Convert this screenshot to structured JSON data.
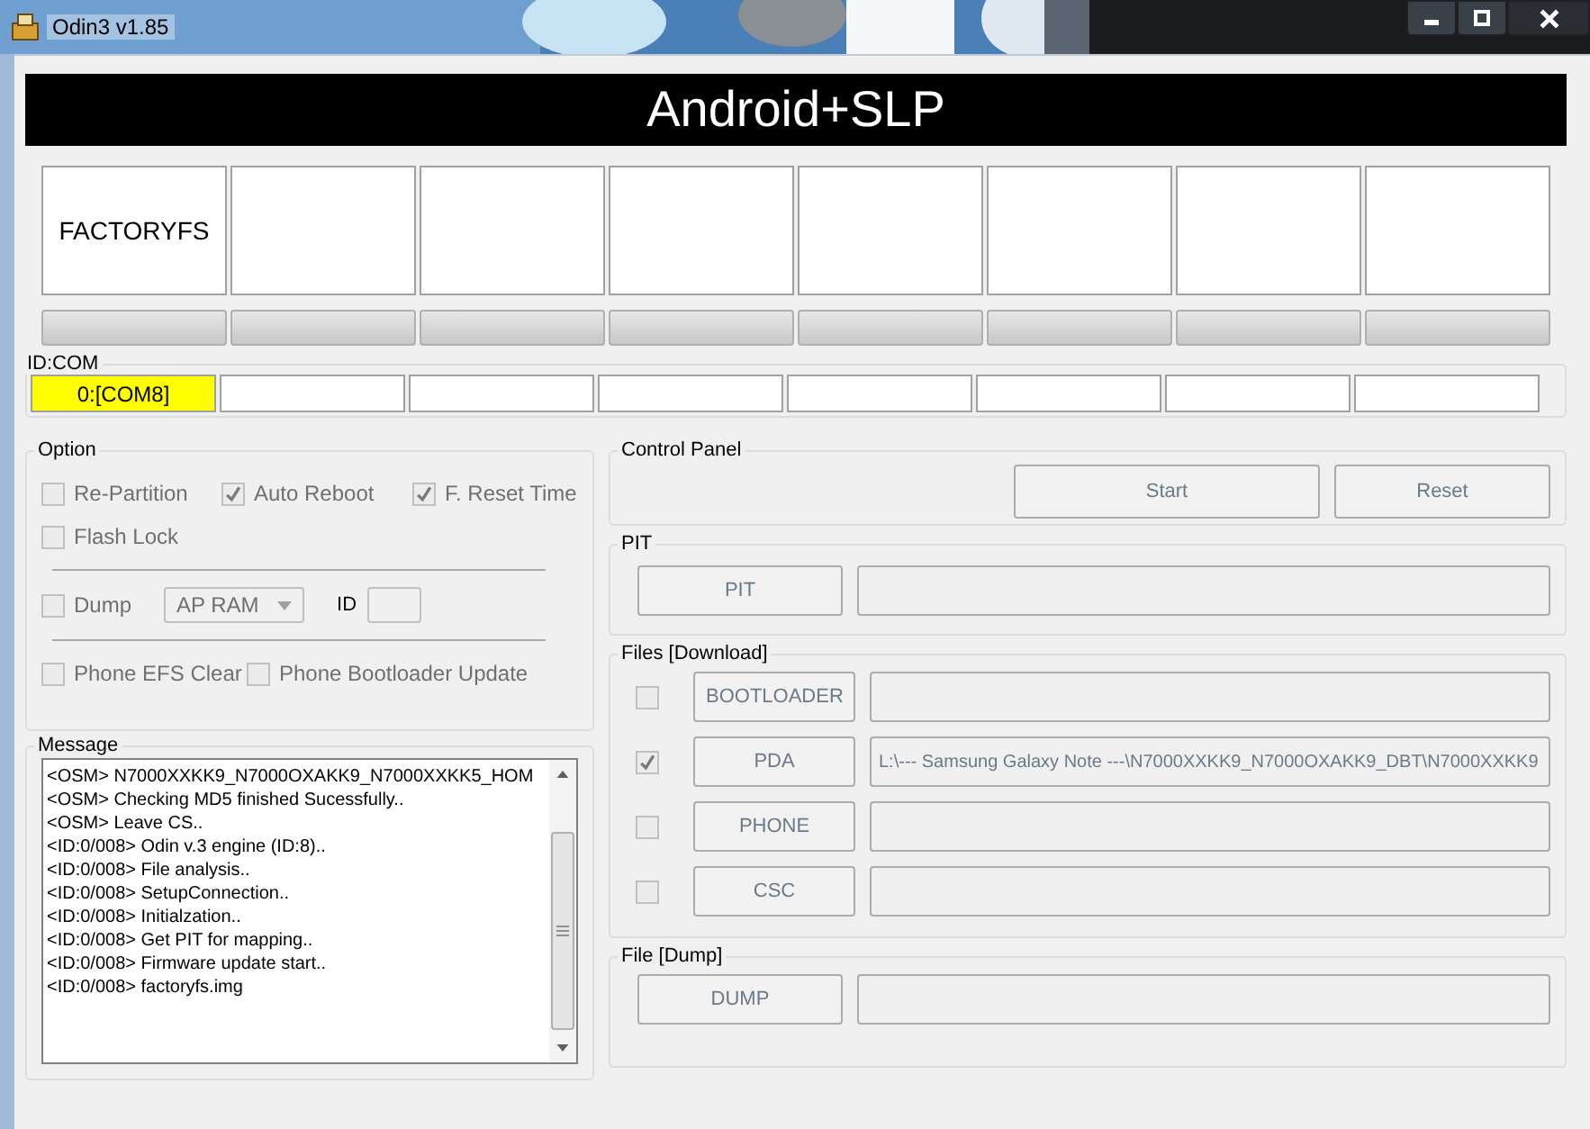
{
  "window": {
    "title": "Odin3 v1.85"
  },
  "banner": "Android+SLP",
  "slots": [
    "FACTORYFS"
  ],
  "progress": [
    {
      "level": 0
    },
    {
      "level": 0
    },
    {
      "level": 0
    },
    {
      "level": 0
    },
    {
      "level": 0
    },
    {
      "level": 0
    },
    {
      "level": 0
    },
    {
      "level": 0
    }
  ],
  "id_com": {
    "label": "ID:COM",
    "ports": [
      {
        "label": "0:[COM8]",
        "active": true
      },
      {
        "active": false
      },
      {
        "active": false
      },
      {
        "active": false
      },
      {
        "active": false
      },
      {
        "active": false
      },
      {
        "active": false
      },
      {
        "active": false
      }
    ]
  },
  "option": {
    "title": "Option",
    "rows": [
      [
        {
          "label": "Re-Partition",
          "checked": false
        },
        {
          "label": "Auto Reboot",
          "checked": true
        },
        {
          "label": "F. Reset Time",
          "checked": true
        }
      ],
      [
        {
          "label": "Flash Lock",
          "checked": false
        }
      ]
    ],
    "dump": {
      "label": "Dump",
      "checked": false,
      "dropdown": "AP RAM",
      "id_label": "ID"
    },
    "bottom": [
      {
        "label": "Phone EFS Clear",
        "checked": false
      },
      {
        "label": "Phone Bootloader Update",
        "checked": false
      }
    ]
  },
  "message": {
    "title": "Message",
    "lines": [
      "<OSM> N7000XXKK9_N7000OXAKK9_N7000XXKK5_HOM",
      "<OSM> Checking MD5 finished Sucessfully..",
      "<OSM> Leave CS..",
      "<ID:0/008> Odin v.3 engine (ID:8)..",
      "<ID:0/008> File analysis..",
      "<ID:0/008> SetupConnection..",
      "<ID:0/008> Initialzation..",
      "<ID:0/008> Get PIT for mapping..",
      "<ID:0/008> Firmware update start..",
      "<ID:0/008> factoryfs.img"
    ]
  },
  "control_panel": {
    "title": "Control Panel",
    "buttons": [
      "Start",
      "Reset"
    ]
  },
  "pit": {
    "title": "PIT",
    "button": "PIT"
  },
  "files": {
    "title": "Files [Download]",
    "items": [
      {
        "button": "BOOTLOADER",
        "checked": false
      },
      {
        "button": "PDA",
        "checked": true,
        "path": "L:\\--- Samsung Galaxy Note ---\\N7000XXKK9_N7000OXAKK9_DBT\\N7000XXKK9"
      },
      {
        "button": "PHONE",
        "checked": false
      },
      {
        "button": "CSC",
        "checked": false
      }
    ]
  },
  "dump": {
    "title": "File [Dump]",
    "button": "DUMP"
  }
}
